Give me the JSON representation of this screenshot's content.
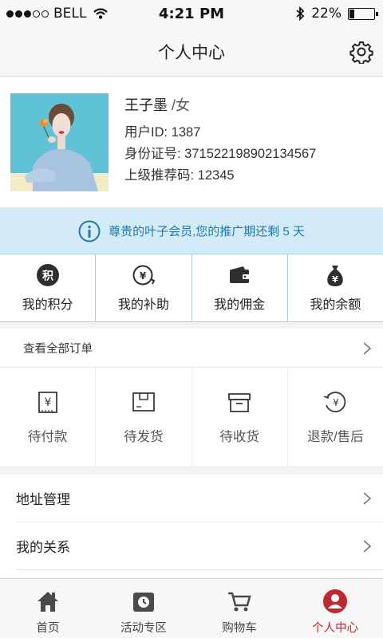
{
  "status_bar": {
    "carrier": "BELL",
    "time": "4:21 PM",
    "battery": "22%",
    "battery_level": 0.22
  },
  "nav": {
    "title": "个人中心",
    "settings_icon": "gear-icon"
  },
  "profile": {
    "name": "王子墨",
    "gender": "/女",
    "user_id": "用户ID:  1387",
    "id_card": "身份证号:  371522198902134567",
    "referral": "上级推荐码:  12345"
  },
  "notice": {
    "text": "尊贵的叶子会员,您的推广期还剩 5 天",
    "icon": "info-icon"
  },
  "wallet": [
    {
      "label": "我的积分",
      "icon": "points-icon"
    },
    {
      "label": "我的补助",
      "icon": "subsidy-icon"
    },
    {
      "label": "我的佣金",
      "icon": "wallet-icon"
    },
    {
      "label": "我的余额",
      "icon": "money-bag-icon"
    }
  ],
  "orders": {
    "view_all": "查看全部订单",
    "items": [
      {
        "label": "待付款",
        "icon": "pending-payment-icon"
      },
      {
        "label": "待发货",
        "icon": "pending-shipment-icon"
      },
      {
        "label": "待收货",
        "icon": "pending-receipt-icon"
      },
      {
        "label": "退款/售后",
        "icon": "refund-icon"
      }
    ]
  },
  "menu": [
    {
      "label": "地址管理"
    },
    {
      "label": "我的关系"
    }
  ],
  "tabs": [
    {
      "label": "首页",
      "icon": "home-icon"
    },
    {
      "label": "活动专区",
      "icon": "activity-icon"
    },
    {
      "label": "购物车",
      "icon": "cart-icon"
    },
    {
      "label": "个人中心",
      "icon": "profile-icon",
      "active": true
    }
  ],
  "colors": {
    "accent_red": "#c1272d",
    "notice_bg": "#d3ebf7",
    "notice_text": "#2278a8",
    "icon_dark": "#3a3a3a"
  }
}
